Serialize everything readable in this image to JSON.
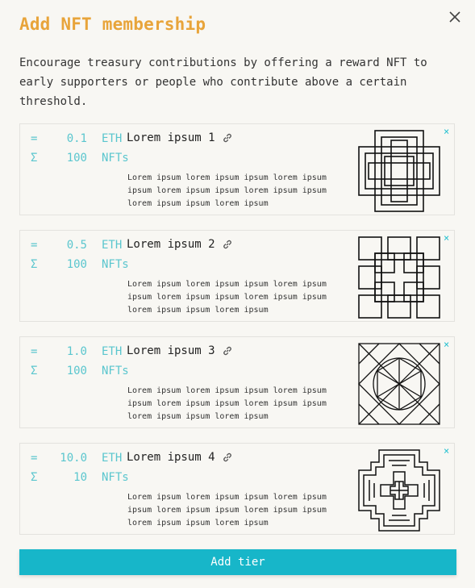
{
  "modal": {
    "title": "Add NFT membership",
    "description": "Encourage treasury contributions by offering a reward NFT to early supporters or people who contribute above a certain threshold.",
    "add_button_label": "Add tier",
    "accent_color": "#e8a43a",
    "button_color": "#17b6c9",
    "value_color": "#5ac6ce"
  },
  "tiers": [
    {
      "price_symbol": "=",
      "price": "0.1",
      "price_unit": "ETH",
      "count_symbol": "Σ",
      "count": "100",
      "count_unit": "NFTs",
      "name": "Lorem ipsum 1",
      "body": "Lorem ipsum lorem ipsum ipsum lorem ipsum ipsum lorem ipsum ipsum lorem ipsum ipsum lorem ipsum ipsum lorem ipsum",
      "remove_label": "×"
    },
    {
      "price_symbol": "=",
      "price": "0.5",
      "price_unit": "ETH",
      "count_symbol": "Σ",
      "count": "100",
      "count_unit": "NFTs",
      "name": "Lorem ipsum 2",
      "body": "Lorem ipsum lorem ipsum ipsum lorem ipsum ipsum lorem ipsum ipsum lorem ipsum ipsum lorem ipsum ipsum lorem ipsum",
      "remove_label": "×"
    },
    {
      "price_symbol": "=",
      "price": "1.0",
      "price_unit": "ETH",
      "count_symbol": "Σ",
      "count": "100",
      "count_unit": "NFTs",
      "name": "Lorem ipsum 3",
      "body": "Lorem ipsum lorem ipsum ipsum lorem ipsum ipsum lorem ipsum ipsum lorem ipsum ipsum lorem ipsum ipsum lorem ipsum",
      "remove_label": "×"
    },
    {
      "price_symbol": "=",
      "price": "10.0",
      "price_unit": "ETH",
      "count_symbol": "Σ",
      "count": "10",
      "count_unit": "NFTs",
      "name": "Lorem ipsum 4",
      "body": "Lorem ipsum lorem ipsum ipsum lorem ipsum ipsum lorem ipsum ipsum lorem ipsum ipsum lorem ipsum ipsum lorem ipsum",
      "remove_label": "×"
    }
  ]
}
